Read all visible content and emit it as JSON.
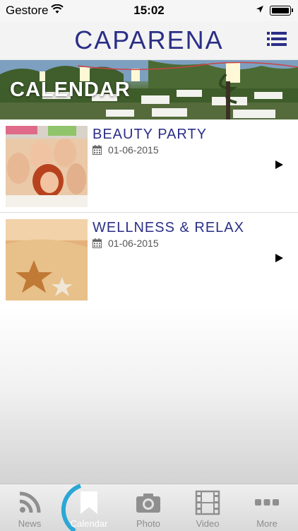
{
  "status_bar": {
    "carrier": "Gestore",
    "time": "15:02"
  },
  "header": {
    "brand": "CAPARENA"
  },
  "hero": {
    "title": "CALENDAR"
  },
  "events": [
    {
      "title": "BEAUTY PARTY",
      "date": "01-06-2015"
    },
    {
      "title": "WELLNESS & RELAX",
      "date": "01-06-2015"
    }
  ],
  "tabs": [
    {
      "label": "News",
      "icon": "rss-icon"
    },
    {
      "label": "Calendar",
      "icon": "bookmark-icon"
    },
    {
      "label": "Photo",
      "icon": "camera-icon"
    },
    {
      "label": "Video",
      "icon": "film-icon"
    },
    {
      "label": "More",
      "icon": "more-icon"
    }
  ],
  "colors": {
    "brand": "#2b2f86",
    "accent_ring": "#2aa7d6"
  }
}
